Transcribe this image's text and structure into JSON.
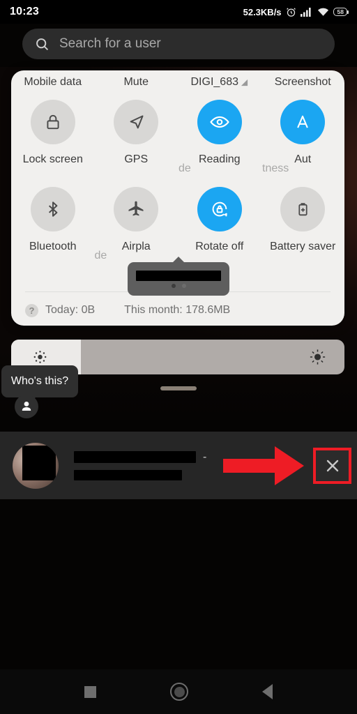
{
  "status_bar": {
    "clock": "10:23",
    "net_speed": "52.3KB/s",
    "battery_level": "58",
    "icons": [
      "alarm-icon",
      "signal-icon",
      "wifi-icon",
      "battery-icon"
    ]
  },
  "search": {
    "placeholder": "Search for a user",
    "value": "",
    "icon": "search-icon"
  },
  "quick_settings": {
    "top_labels": [
      "Mobile data",
      "Mute",
      "DIGI_683",
      "Screenshot"
    ],
    "row1": [
      {
        "label": "Lock screen",
        "icon": "lock-icon",
        "active": false
      },
      {
        "label": "GPS",
        "icon": "location-arrow-icon",
        "active": false
      },
      {
        "label": "Reading",
        "icon": "eye-icon",
        "active": true
      },
      {
        "label": "Aut",
        "icon": "auto-brightness-a-icon",
        "active": true
      }
    ],
    "row1_ghost_labels": [
      "",
      "",
      "de",
      "tness"
    ],
    "row2": [
      {
        "label": "Bluetooth",
        "icon": "bluetooth-icon",
        "active": false
      },
      {
        "label": "Airpla",
        "icon": "airplane-icon",
        "active": false
      },
      {
        "label": "Rotate off",
        "icon": "rotate-lock-icon",
        "active": true
      },
      {
        "label": "Battery saver",
        "icon": "battery-plus-icon",
        "active": false
      }
    ],
    "row2_ghost_labels": [
      "",
      "de",
      "",
      ""
    ],
    "usage": {
      "help_icon": "question-mark-icon",
      "today": "Today: 0B",
      "this_month": "This month: 178.6MB"
    },
    "tooltip": {
      "text_redacted": true,
      "page_dots": 2,
      "active_dot": 0
    }
  },
  "brightness": {
    "level_percent": 21,
    "low_icon": "brightness-low-icon",
    "high_icon": "brightness-high-icon"
  },
  "whos_this_tooltip": {
    "text": "Who's this?",
    "icon": "account-circle-icon"
  },
  "result_row": {
    "avatar": "user-photo-avatar",
    "name_redacted": true,
    "subtitle_redacted": true,
    "separator": "-",
    "close_label": "×",
    "close_icon": "close-icon"
  },
  "annotation": {
    "arrow": "red-arrow-right",
    "arrow_color": "#ee1c25",
    "highlight_color": "#ee1c25"
  },
  "nav_bar": {
    "recents": "recents-square-icon",
    "home": "home-circle-icon",
    "back": "back-triangle-icon"
  },
  "colors": {
    "accent_blue": "#1ba6f2",
    "panel_bg": "#f1f0ee",
    "row_bg": "#262626",
    "annotation_red": "#ee1c25"
  }
}
